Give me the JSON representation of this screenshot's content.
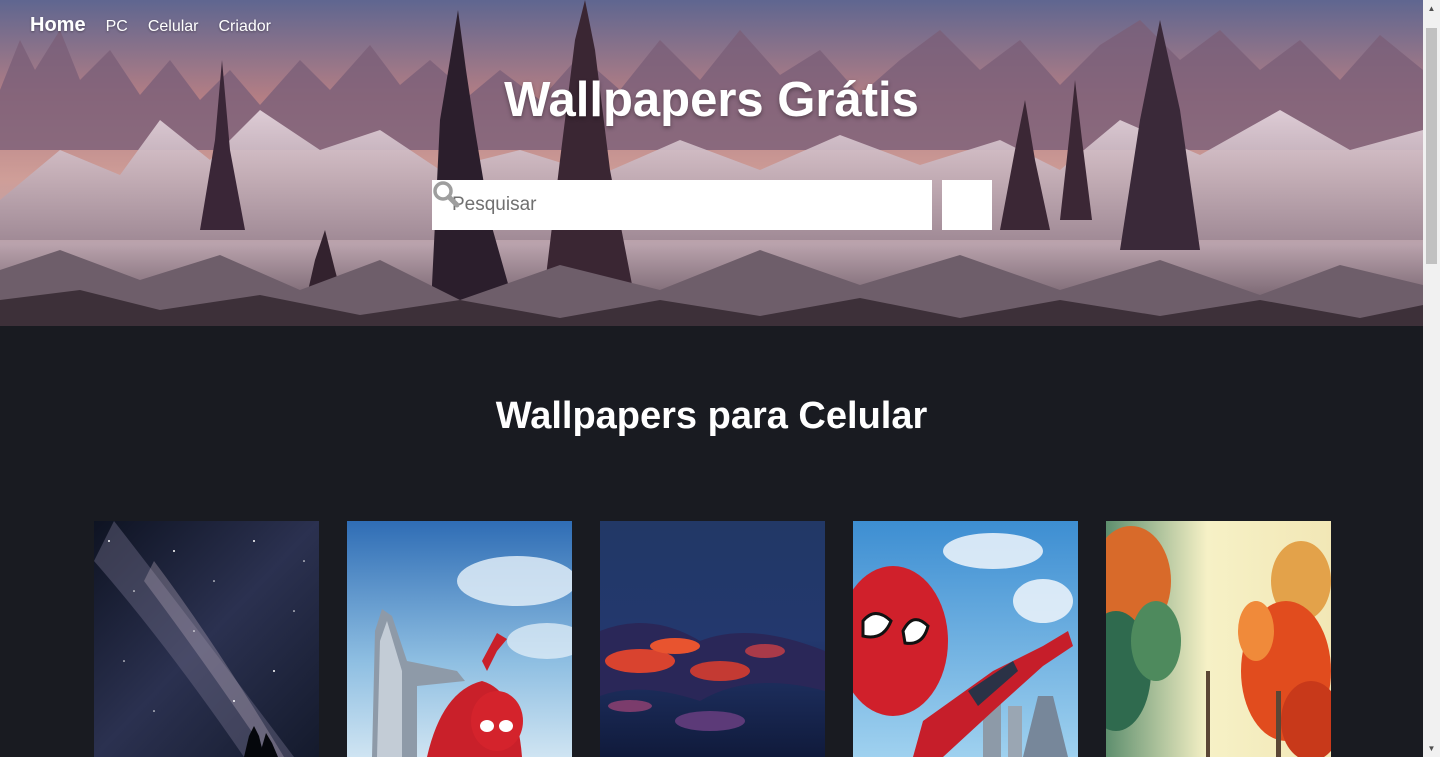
{
  "nav": {
    "items": [
      {
        "label": "Home"
      },
      {
        "label": "PC"
      },
      {
        "label": "Celular"
      },
      {
        "label": "Criador"
      }
    ]
  },
  "hero": {
    "title": "Wallpapers Grátis",
    "search_placeholder": "Pesquisar",
    "search_icon": "search-icon"
  },
  "section": {
    "title": "Wallpapers para Celular"
  },
  "gallery": {
    "cards": [
      {
        "subject": "milky-way-night-sky"
      },
      {
        "subject": "spider-man-avengers-tower"
      },
      {
        "subject": "abstract-red-blue-clouds"
      },
      {
        "subject": "spider-man-selfie-sky"
      },
      {
        "subject": "autumn-trees"
      }
    ]
  },
  "colors": {
    "page_background": "#191b21",
    "text": "#ffffff",
    "input_background": "#ffffff"
  }
}
